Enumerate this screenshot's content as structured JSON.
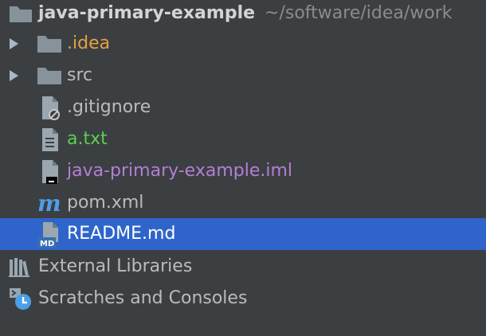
{
  "project_tree": {
    "root": {
      "name": "java-primary-example",
      "path": "~/software/idea/work",
      "icon": "folder-icon"
    },
    "items": [
      {
        "label": ".idea",
        "icon": "folder-icon",
        "color": "#e6a042",
        "expandable": true
      },
      {
        "label": "src",
        "icon": "folder-icon",
        "color": "#bbbbbb",
        "expandable": true
      },
      {
        "label": ".gitignore",
        "icon": "ignored-file-icon",
        "color": "#bbbbbb"
      },
      {
        "label": "a.txt",
        "icon": "text-file-icon",
        "color": "#5ccf4d"
      },
      {
        "label": "java-primary-example.iml",
        "icon": "iml-file-icon",
        "color": "#b47ed6"
      },
      {
        "label": "pom.xml",
        "icon": "maven-icon",
        "color": "#bbbbbb"
      },
      {
        "label": "README.md",
        "icon": "markdown-file-icon",
        "color": "#ffffff",
        "selected": true
      }
    ],
    "extra": [
      {
        "label": "External Libraries",
        "icon": "libraries-icon"
      },
      {
        "label": "Scratches and Consoles",
        "icon": "scratches-icon"
      }
    ],
    "colors": {
      "background": "#3c3f41",
      "selection": "#2f65ca"
    }
  }
}
